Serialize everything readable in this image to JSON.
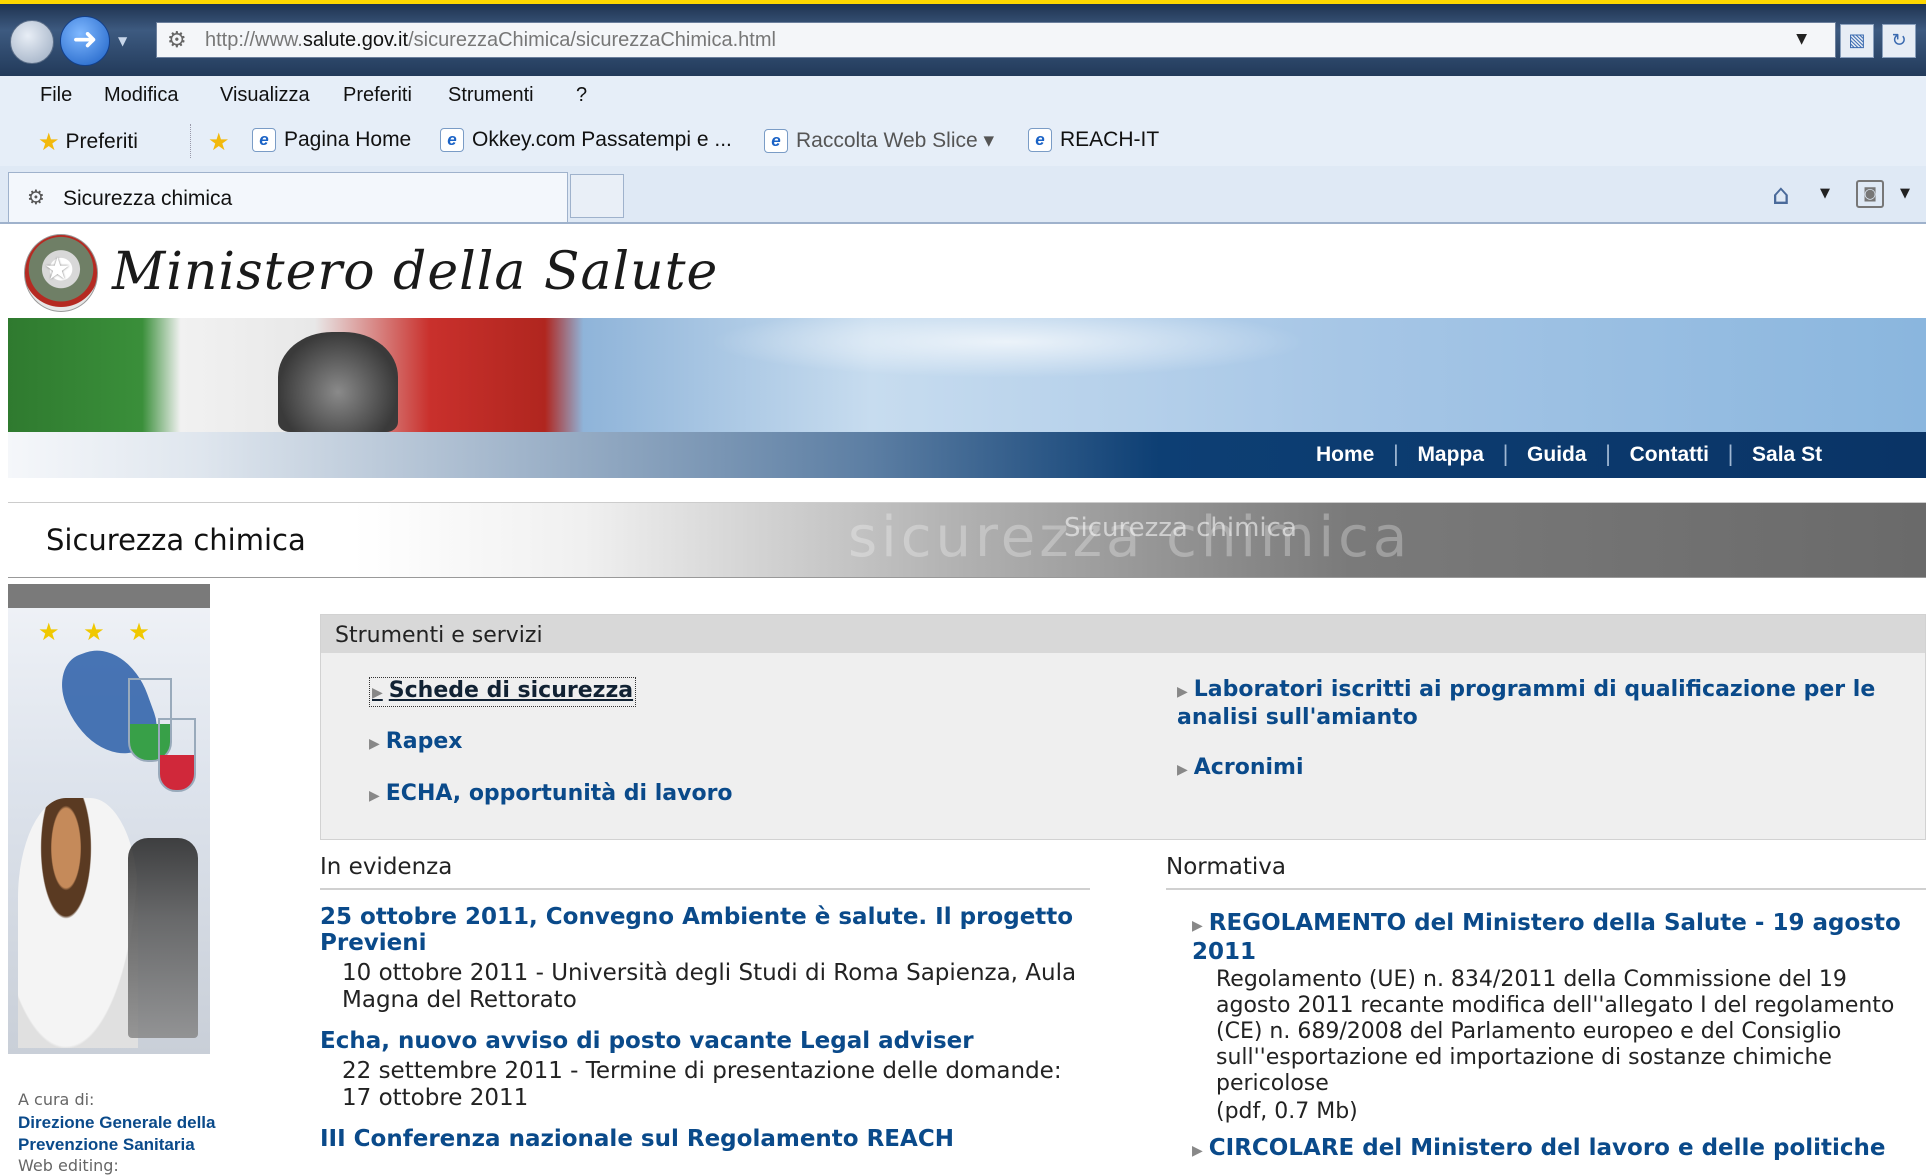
{
  "browser": {
    "url_prefix": "http://www.",
    "url_domain": "salute.gov.it",
    "url_path": "/sicurezzaChimica/sicurezzaChimica.html",
    "menu": [
      "File",
      "Modifica",
      "Visualizza",
      "Preferiti",
      "Strumenti",
      "?"
    ],
    "favorites_label": "Preferiti",
    "favorites_bar": [
      "Pagina Home",
      "Okkey.com Passatempi e ...",
      "Raccolta Web Slice ▾",
      "REACH-IT"
    ],
    "tab_title": "Sicurezza chimica",
    "icons": {
      "back": "back-arrow-icon",
      "forward": "forward-arrow-icon",
      "page": "gear-icon",
      "home": "home-icon",
      "feed": "feed-icon"
    }
  },
  "site": {
    "name": "Ministero della Salute",
    "top_nav": [
      "Home",
      "Mappa",
      "Guida",
      "Contatti",
      "Sala St"
    ],
    "section_title": "Sicurezza chimica",
    "section_ghost": "sicurezza chimica",
    "section_ghost_small": "Sicurezza chimica"
  },
  "left": {
    "credit_label": "A cura di:",
    "credit_link": "Direzione Generale della Prevenzione Sanitaria",
    "web_editing": "Web editing:"
  },
  "tools": {
    "title": "Strumenti e servizi",
    "links": [
      "Schede di sicurezza",
      "Rapex",
      "ECHA, opportunità di lavoro",
      "Laboratori iscritti ai programmi di qualificazione per le analisi sull'amianto",
      "Acronimi"
    ]
  },
  "evidenza": {
    "title": "In evidenza",
    "items": [
      {
        "title": "25 ottobre 2011, Convegno Ambiente è salute. Il progetto Previeni",
        "desc": "10 ottobre 2011 - Università degli Studi di Roma Sapienza, Aula Magna del Rettorato"
      },
      {
        "title": "Echa, nuovo avviso di posto vacante Legal adviser",
        "desc": "22 settembre 2011 - Termine di presentazione delle domande: 17 ottobre 2011"
      },
      {
        "title": "III Conferenza nazionale sul Regolamento REACH",
        "desc": ""
      }
    ]
  },
  "normativa": {
    "title": "Normativa",
    "items": [
      {
        "title": "REGOLAMENTO del Ministero della Salute - 19 agosto 2011",
        "desc": "Regolamento (UE) n. 834/2011 della Commissione del 19 agosto 2011 recante modifica dell''allegato I del regolamento (CE) n. 689/2008 del Parlamento europeo e del Consiglio sull''esportazione ed importazione di sostanze chimiche pericolose",
        "file": "(pdf, 0.7 Mb)"
      },
      {
        "title": "CIRCOLARE del Ministero del lavoro e delle politiche",
        "desc": "",
        "file": ""
      }
    ]
  },
  "colors": {
    "link": "#0a4a8a",
    "nav_bar": "#0a3466",
    "tools_bg": "#efefef"
  }
}
